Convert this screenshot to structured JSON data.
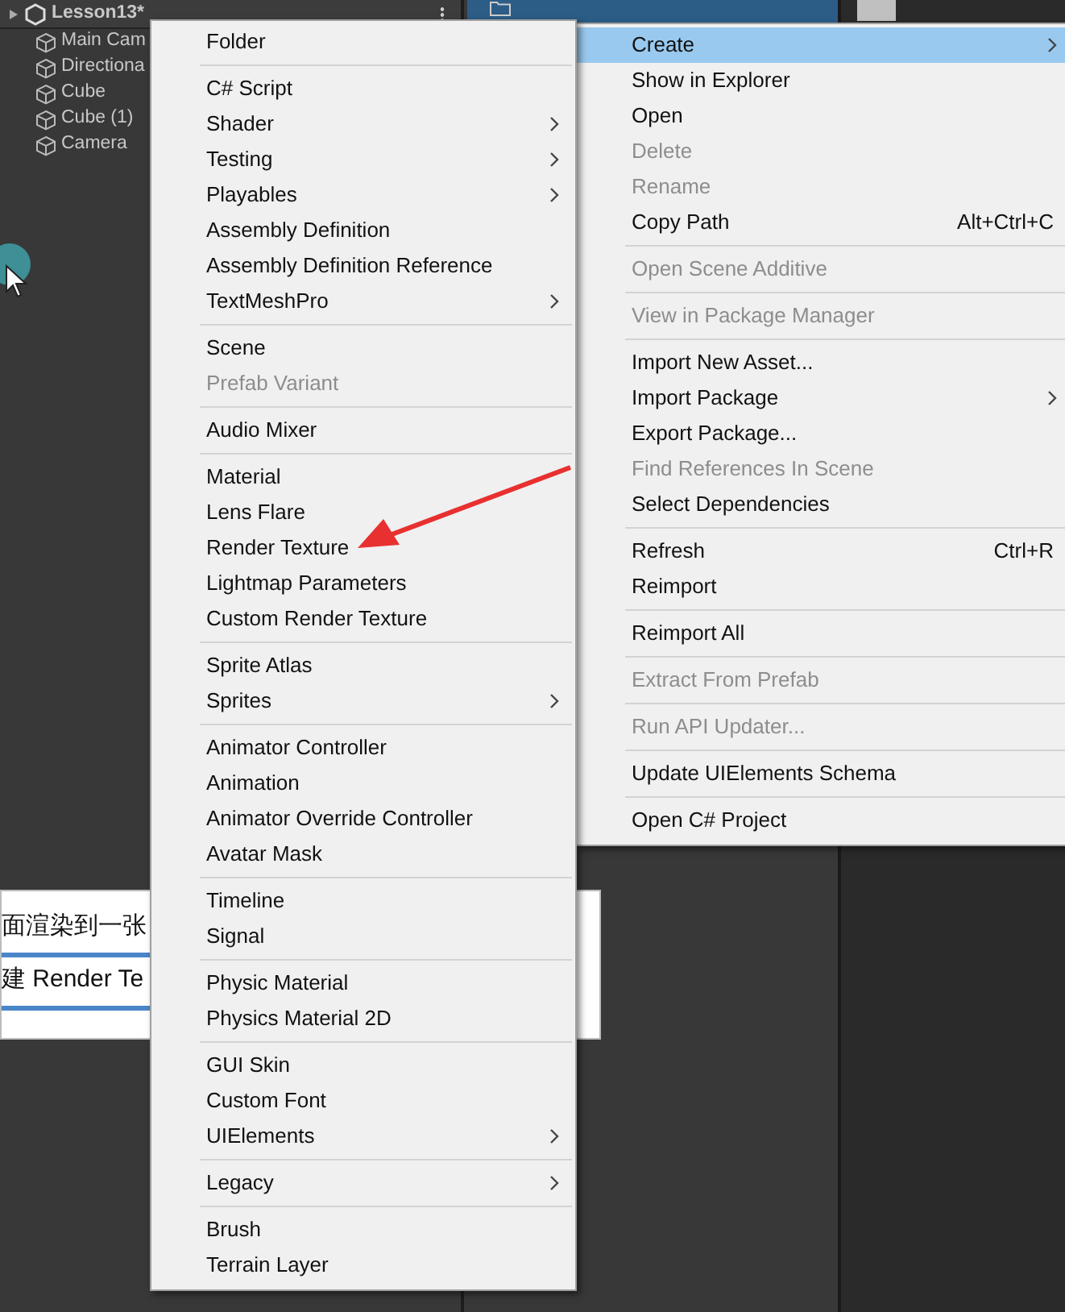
{
  "hierarchy": {
    "scene": "Lesson13*",
    "items": [
      "Main Cam",
      "Directiona",
      "Cube",
      "Cube (1)",
      "Camera"
    ]
  },
  "doc": {
    "lines": [
      "面渲染到一张",
      "建 Render Te"
    ]
  },
  "create_menu": {
    "sections": [
      [
        {
          "label": "Folder",
          "submenu": false,
          "disabled": false
        }
      ],
      [
        {
          "label": "C# Script",
          "submenu": false,
          "disabled": false
        },
        {
          "label": "Shader",
          "submenu": true,
          "disabled": false
        },
        {
          "label": "Testing",
          "submenu": true,
          "disabled": false
        },
        {
          "label": "Playables",
          "submenu": true,
          "disabled": false
        },
        {
          "label": "Assembly Definition",
          "submenu": false,
          "disabled": false
        },
        {
          "label": "Assembly Definition Reference",
          "submenu": false,
          "disabled": false
        },
        {
          "label": "TextMeshPro",
          "submenu": true,
          "disabled": false
        }
      ],
      [
        {
          "label": "Scene",
          "submenu": false,
          "disabled": false
        },
        {
          "label": "Prefab Variant",
          "submenu": false,
          "disabled": true
        }
      ],
      [
        {
          "label": "Audio Mixer",
          "submenu": false,
          "disabled": false
        }
      ],
      [
        {
          "label": "Material",
          "submenu": false,
          "disabled": false
        },
        {
          "label": "Lens Flare",
          "submenu": false,
          "disabled": false
        },
        {
          "label": "Render Texture",
          "submenu": false,
          "disabled": false
        },
        {
          "label": "Lightmap Parameters",
          "submenu": false,
          "disabled": false
        },
        {
          "label": "Custom Render Texture",
          "submenu": false,
          "disabled": false
        }
      ],
      [
        {
          "label": "Sprite Atlas",
          "submenu": false,
          "disabled": false
        },
        {
          "label": "Sprites",
          "submenu": true,
          "disabled": false
        }
      ],
      [
        {
          "label": "Animator Controller",
          "submenu": false,
          "disabled": false
        },
        {
          "label": "Animation",
          "submenu": false,
          "disabled": false
        },
        {
          "label": "Animator Override Controller",
          "submenu": false,
          "disabled": false
        },
        {
          "label": "Avatar Mask",
          "submenu": false,
          "disabled": false
        }
      ],
      [
        {
          "label": "Timeline",
          "submenu": false,
          "disabled": false
        },
        {
          "label": "Signal",
          "submenu": false,
          "disabled": false
        }
      ],
      [
        {
          "label": "Physic Material",
          "submenu": false,
          "disabled": false
        },
        {
          "label": "Physics Material 2D",
          "submenu": false,
          "disabled": false
        }
      ],
      [
        {
          "label": "GUI Skin",
          "submenu": false,
          "disabled": false
        },
        {
          "label": "Custom Font",
          "submenu": false,
          "disabled": false
        },
        {
          "label": "UIElements",
          "submenu": true,
          "disabled": false
        }
      ],
      [
        {
          "label": "Legacy",
          "submenu": true,
          "disabled": false
        }
      ],
      [
        {
          "label": "Brush",
          "submenu": false,
          "disabled": false
        },
        {
          "label": "Terrain Layer",
          "submenu": false,
          "disabled": false
        }
      ]
    ]
  },
  "context_menu": {
    "sections": [
      [
        {
          "label": "Create",
          "submenu": true,
          "disabled": false,
          "selected": true
        },
        {
          "label": "Show in Explorer",
          "submenu": false,
          "disabled": false,
          "selected": false
        },
        {
          "label": "Open",
          "submenu": false,
          "disabled": false,
          "selected": false
        },
        {
          "label": "Delete",
          "submenu": false,
          "disabled": true,
          "selected": false
        },
        {
          "label": "Rename",
          "submenu": false,
          "disabled": true,
          "selected": false
        },
        {
          "label": "Copy Path",
          "shortcut": "Alt+Ctrl+C",
          "submenu": false,
          "disabled": false,
          "selected": false
        }
      ],
      [
        {
          "label": "Open Scene Additive",
          "submenu": false,
          "disabled": true,
          "selected": false
        }
      ],
      [
        {
          "label": "View in Package Manager",
          "submenu": false,
          "disabled": true,
          "selected": false
        }
      ],
      [
        {
          "label": "Import New Asset...",
          "submenu": false,
          "disabled": false,
          "selected": false
        },
        {
          "label": "Import Package",
          "submenu": true,
          "disabled": false,
          "selected": false
        },
        {
          "label": "Export Package...",
          "submenu": false,
          "disabled": false,
          "selected": false
        },
        {
          "label": "Find References In Scene",
          "submenu": false,
          "disabled": true,
          "selected": false
        },
        {
          "label": "Select Dependencies",
          "submenu": false,
          "disabled": false,
          "selected": false
        }
      ],
      [
        {
          "label": "Refresh",
          "shortcut": "Ctrl+R",
          "submenu": false,
          "disabled": false,
          "selected": false
        },
        {
          "label": "Reimport",
          "submenu": false,
          "disabled": false,
          "selected": false
        }
      ],
      [
        {
          "label": "Reimport All",
          "submenu": false,
          "disabled": false,
          "selected": false
        }
      ],
      [
        {
          "label": "Extract From Prefab",
          "submenu": false,
          "disabled": true,
          "selected": false
        }
      ],
      [
        {
          "label": "Run API Updater...",
          "submenu": false,
          "disabled": true,
          "selected": false
        }
      ],
      [
        {
          "label": "Update UIElements Schema",
          "submenu": false,
          "disabled": false,
          "selected": false
        }
      ],
      [
        {
          "label": "Open C# Project",
          "submenu": false,
          "disabled": false,
          "selected": false
        }
      ]
    ]
  }
}
